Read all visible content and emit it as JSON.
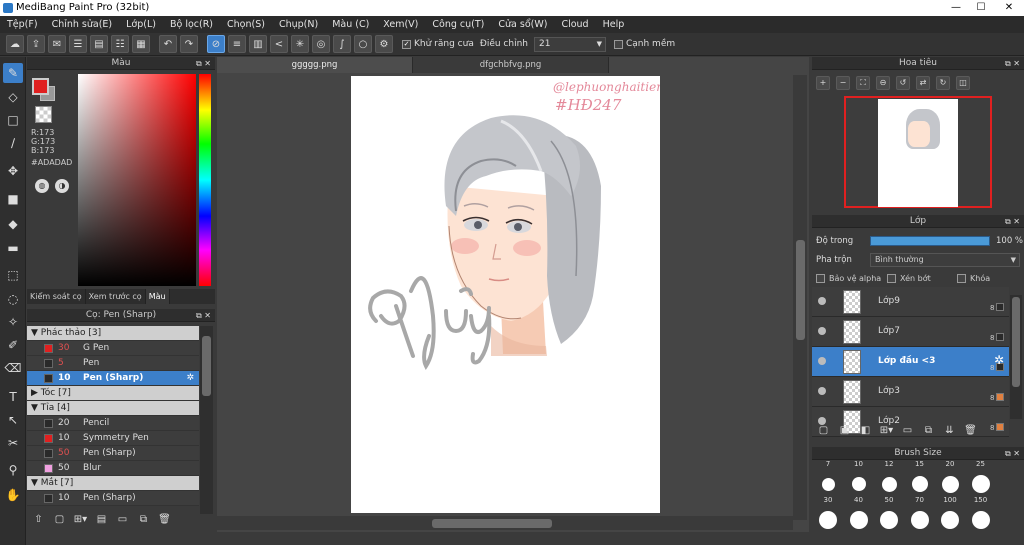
{
  "window": {
    "title": "MediBang Paint Pro (32bit)",
    "minimize": "—",
    "maximize": "☐",
    "close": "✕"
  },
  "menu": [
    "Tệp(F)",
    "Chỉnh sửa(E)",
    "Lớp(L)",
    "Bộ lọc(R)",
    "Chọn(S)",
    "Chụp(N)",
    "Màu (C)",
    "Xem(V)",
    "Công cụ(T)",
    "Cửa sổ(W)",
    "Cloud",
    "Help"
  ],
  "toolbar": {
    "antialias_label": "Khử răng cưa",
    "adjust_label": "Điều chỉnh",
    "adjust_value": "21",
    "smooth_edge_label": "Cạnh mềm"
  },
  "color_panel": {
    "title": "Màu",
    "fg_color": "#e02020",
    "r": "R:173",
    "g": "G:173",
    "b": "B:173",
    "hex": "#ADADAD",
    "tabs": [
      "Kiểm soát cọ",
      "Xem trước cọ",
      "Màu"
    ]
  },
  "brush_panel": {
    "title": "Cọ: Pen (Sharp)",
    "rows": [
      {
        "type": "group",
        "label": "Phác thảo [3]",
        "arrow": "▼"
      },
      {
        "type": "item",
        "size": "30",
        "name": "G Pen",
        "color": "#e02020",
        "size_color": "#e05050"
      },
      {
        "type": "item",
        "size": "5",
        "name": "Pen",
        "color": "#2a2a2a",
        "size_color": "#e05050"
      },
      {
        "type": "item",
        "size": "10",
        "name": "Pen (Sharp)",
        "color": "#2a2a2a",
        "size_color": "#ffffff",
        "selected": true
      },
      {
        "type": "group",
        "label": "Tóc [7]",
        "arrow": "▶"
      },
      {
        "type": "group",
        "label": "Tỉa [4]",
        "arrow": "▼"
      },
      {
        "type": "item",
        "size": "20",
        "name": "Pencil",
        "color": "#2a2a2a",
        "size_color": "#dddddd"
      },
      {
        "type": "item",
        "size": "10",
        "name": "Symmetry Pen",
        "color": "#e02020",
        "size_color": "#dddddd"
      },
      {
        "type": "item",
        "size": "50",
        "name": "Pen (Sharp)",
        "color": "#2a2a2a",
        "size_color": "#e05050"
      },
      {
        "type": "item",
        "size": "50",
        "name": "Blur",
        "color": "#f0a0e0",
        "size_color": "#dddddd"
      },
      {
        "type": "group",
        "label": "Mắt [7]",
        "arrow": "▼"
      },
      {
        "type": "item",
        "size": "10",
        "name": "Pen (Sharp)",
        "color": "#2a2a2a",
        "size_color": "#dddddd"
      }
    ]
  },
  "doc_tabs": [
    "ggggg.png",
    "dfgchbfvg.png"
  ],
  "artwork": {
    "credit": "@lephuonghaitien",
    "tag": "#HĐ247",
    "signature": "@thùy"
  },
  "navigator": {
    "title": "Hoa tiêu"
  },
  "layers": {
    "title": "Lớp",
    "opacity_label": "Độ trong",
    "opacity_value": "100 %",
    "opacity": 1.0,
    "blend_label": "Pha trộn",
    "blend_value": "Bình thường",
    "protect_alpha": "Bảo vệ alpha",
    "clipping": "Xén bớt",
    "lock": "Khóa",
    "items": [
      {
        "name": "Lớp9",
        "swatch": "#2a2a2a"
      },
      {
        "name": "Lớp7",
        "swatch": "#2a2a2a"
      },
      {
        "name": "Lớp đầu <3",
        "swatch": "#2a2a2a",
        "selected": true
      },
      {
        "name": "Lớp3",
        "swatch": "#e08040"
      },
      {
        "name": "Lớp2",
        "swatch": "#e08040"
      }
    ]
  },
  "brush_size": {
    "title": "Brush Size",
    "row1": [
      "7",
      "10",
      "12",
      "15",
      "20",
      "25"
    ],
    "row2": [
      "30",
      "40",
      "50",
      "70",
      "100",
      "150"
    ]
  }
}
